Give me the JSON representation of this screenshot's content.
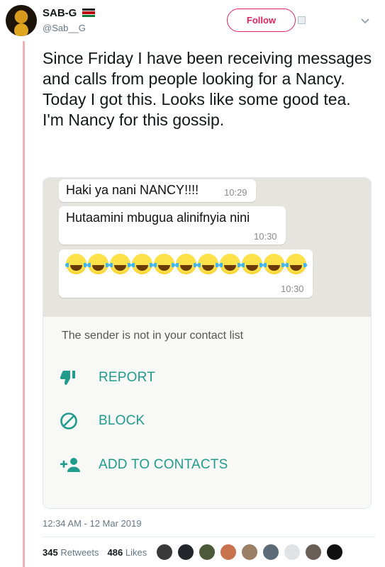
{
  "header": {
    "name": "SAB-G",
    "handle": "@Sab__G",
    "follow_label": "Follow",
    "flag_colors": [
      "#1c1c1c",
      "#bb0000",
      "#0a7a3a"
    ]
  },
  "tweet": {
    "text": "Since Friday I have been receiving messages and calls from people looking for a Nancy.\nToday I got this. Looks like some good tea.\nI'm Nancy for this gossip."
  },
  "chat": {
    "messages": [
      {
        "text": "Haki ya nani NANCY!!!!",
        "time": "10:29"
      },
      {
        "text": "Hutaamini mbugua alinifnyia nini",
        "time": "10:30"
      },
      {
        "emoji": "face-with-tears-of-joy",
        "count": 11,
        "time": "10:30"
      }
    ],
    "notice": "The sender is not in your contact list",
    "actions": [
      {
        "label": "REPORT",
        "icon": "thumbs-down-icon"
      },
      {
        "label": "BLOCK",
        "icon": "block-icon"
      },
      {
        "label": "ADD TO CONTACTS",
        "icon": "add-person-icon"
      }
    ],
    "accent_color": "#1f9c8c"
  },
  "footer": {
    "timestamp": "12:34 AM - 12 Mar 2019",
    "retweets_count": "345",
    "retweets_label": "Retweets",
    "likes_count": "486",
    "likes_label": "Likes"
  },
  "colors": {
    "follow_accent": "#e0245e",
    "thread_line": "#f2aeb6"
  }
}
